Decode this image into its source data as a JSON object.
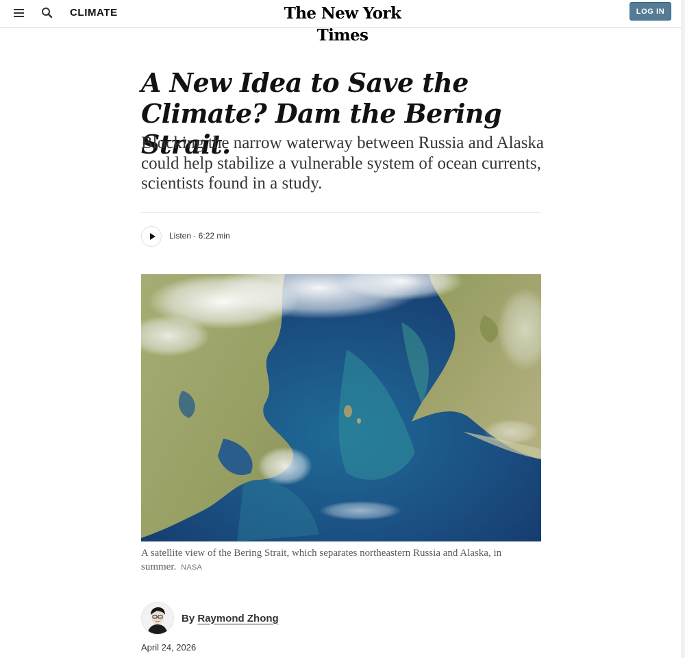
{
  "header": {
    "section_label": "CLIMATE",
    "masthead": "The New York Times",
    "login_label": "LOG IN"
  },
  "article": {
    "headline": "A New Idea to Save the Climate? Dam the Bering Strait.",
    "summary": "Blocking the narrow waterway between Russia and Alaska could help stabilize a vulnerable system of ocean currents, scientists found in a study.",
    "listen_label": "Listen · 6:22 min",
    "image_caption": "A satellite view of the Bering Strait, which separates northeastern Russia and Alaska, in summer.",
    "image_credit": "NASA",
    "byline_prefix": "By",
    "author": "Raymond Zhong",
    "date": "April 24, 2026"
  },
  "colors": {
    "login_button": "#567b95",
    "ocean": "#1d4d7a",
    "land": "#9ea46a"
  },
  "icons": {
    "menu": "hamburger-menu-icon",
    "search": "search-icon",
    "play": "play-icon"
  }
}
